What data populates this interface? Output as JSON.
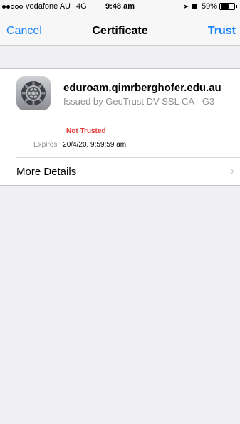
{
  "status_bar": {
    "carrier": "vodafone AU",
    "network": "4G",
    "time": "9:48 am",
    "battery_percent": "59%",
    "battery_level": 0.59,
    "signal_bars_filled": 2,
    "signal_bars_total": 5,
    "icons": [
      "location-arrow-icon",
      "alarm-icon",
      "battery-icon"
    ]
  },
  "nav": {
    "cancel_label": "Cancel",
    "title": "Certificate",
    "trust_label": "Trust"
  },
  "certificate": {
    "name": "eduroam.qimrberghofer.edu.au",
    "issuer": "Issued by GeoTrust DV SSL CA - G3",
    "trust_status": "Not Trusted",
    "expires_label": "Expires",
    "expires_value": "20/4/20, 9:59:59 am",
    "icon": "settings-gear-icon"
  },
  "more_details": {
    "label": "More Details",
    "chevron": "chevron-right-icon"
  },
  "colors": {
    "accent": "#1a86fb",
    "danger": "#e53935",
    "secondary_text": "#8e8e93",
    "background": "#efeff4"
  }
}
